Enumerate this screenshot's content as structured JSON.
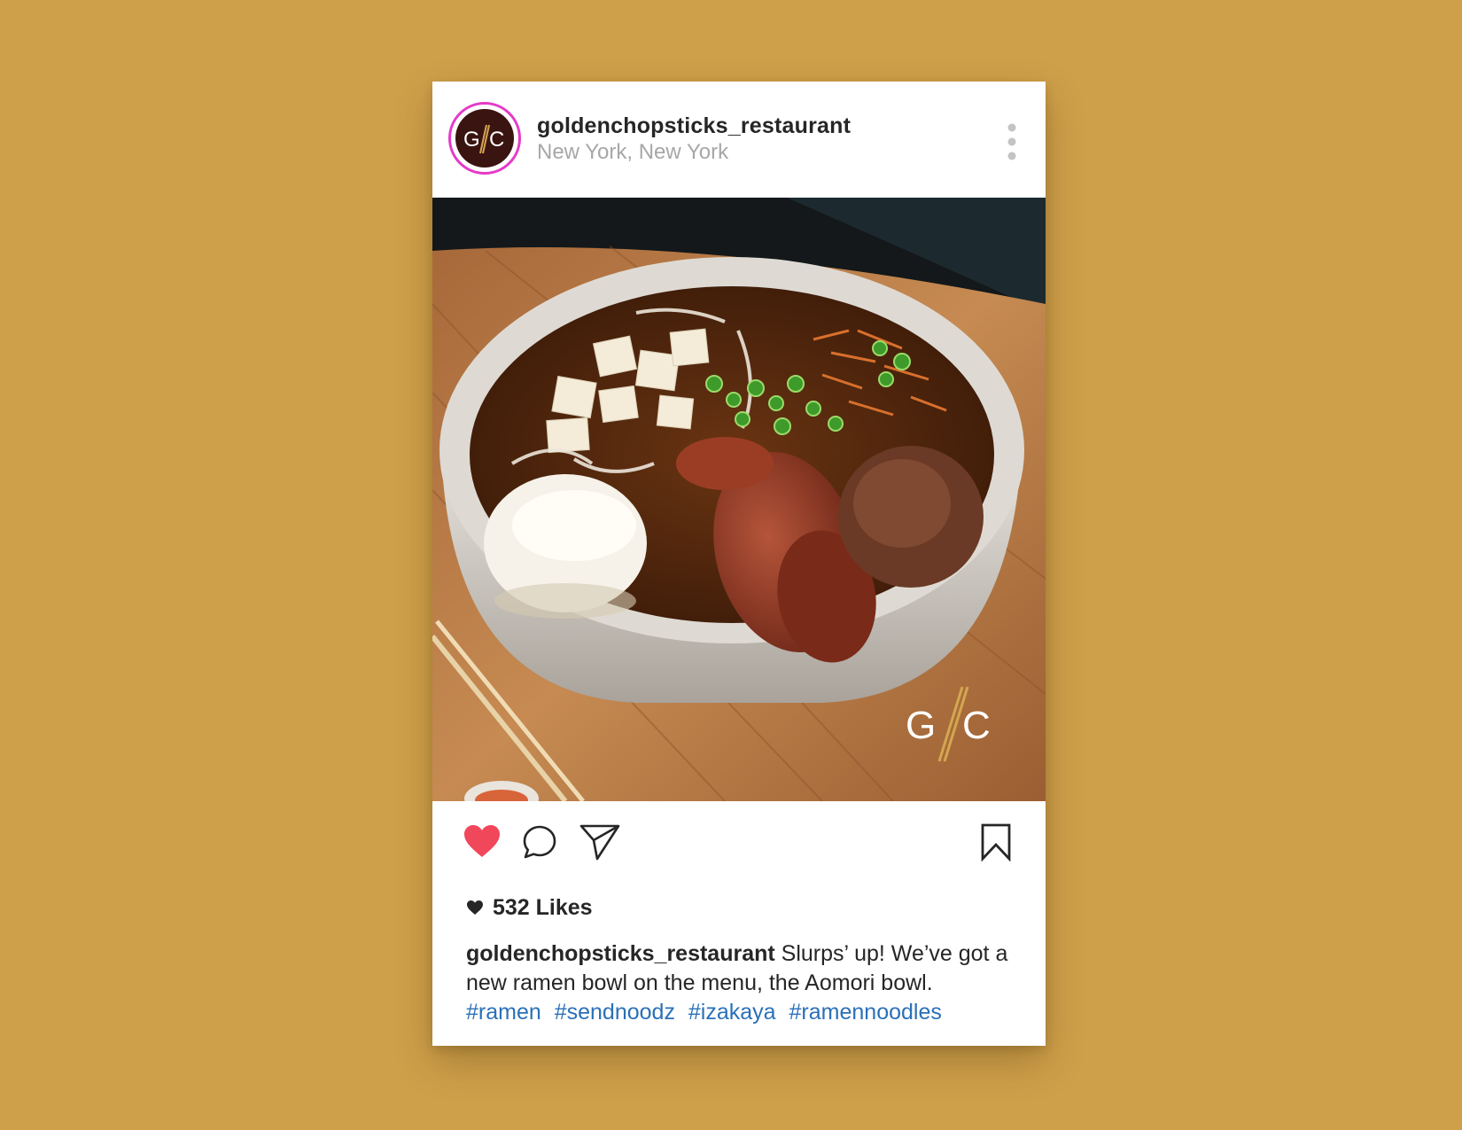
{
  "post": {
    "username": "goldenchopsticks_restaurant",
    "location": "New York, New York",
    "avatar_logo_text": "G/C",
    "watermark_text": "G/C",
    "likes": "532 Likes",
    "caption_user": "goldenchopsticks_restaurant",
    "caption_text": " Slurps’ up! We’ve got a new ramen bowl on the menu, the Aomori bowl.",
    "hashtags": [
      "#ramen",
      "#sendnoodz",
      "#izakaya",
      "#ramennoodles"
    ],
    "liked": true
  },
  "icons": {
    "more": "more-vertical-icon",
    "like": "heart-icon",
    "comment": "comment-icon",
    "share": "send-icon",
    "save": "bookmark-icon",
    "likes_heart": "small-heart-icon"
  },
  "colors": {
    "background": "#cfa04a",
    "story_ring": "#e63ac8",
    "like_red": "#f0475b",
    "hashtag_blue": "#2a70b8"
  }
}
